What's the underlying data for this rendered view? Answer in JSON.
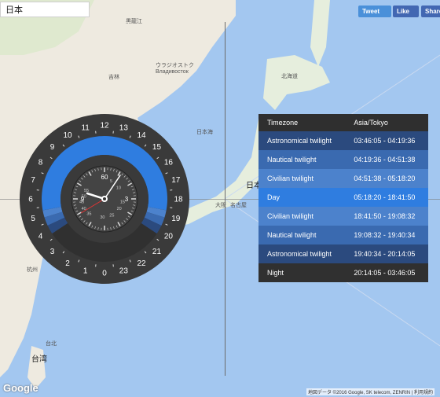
{
  "search": {
    "value": "日本"
  },
  "social": {
    "tweet": "Tweet",
    "like": "Like",
    "share": "Share"
  },
  "colors": {
    "day": "#2f7de0",
    "civil": "#4c82cc",
    "nautical": "#3a6ab0",
    "astro": "#2b4a7e",
    "night": "#303030",
    "dial": "#3a3a3a"
  },
  "clock": {
    "hour_labels": [
      "0",
      "1",
      "2",
      "3",
      "4",
      "5",
      "6",
      "7",
      "8",
      "9",
      "10",
      "11",
      "12",
      "13",
      "14",
      "15",
      "16",
      "17",
      "18",
      "19",
      "20",
      "21",
      "22",
      "23"
    ],
    "inner_labels": [
      "55",
      "50",
      "45",
      "40",
      "35",
      "30",
      "25",
      "20",
      "15",
      "10",
      "5",
      "3",
      "9",
      "60"
    ]
  },
  "timezone_table": {
    "header": {
      "label": "Timezone",
      "value": "Asia/Tokyo"
    },
    "rows": [
      {
        "label": "Astronomical twilight",
        "value": "03:46:05 - 04:19:36",
        "color": "#2b4a7e"
      },
      {
        "label": "Nautical twilight",
        "value": "04:19:36 - 04:51:38",
        "color": "#3a6ab0"
      },
      {
        "label": "Civilian twilight",
        "value": "04:51:38 - 05:18:20",
        "color": "#4c82cc"
      },
      {
        "label": "Day",
        "value": "05:18:20 - 18:41:50",
        "color": "#2f7de0"
      },
      {
        "label": "Civilian twilight",
        "value": "18:41:50 - 19:08:32",
        "color": "#4c82cc"
      },
      {
        "label": "Nautical twilight",
        "value": "19:08:32 - 19:40:34",
        "color": "#3a6ab0"
      },
      {
        "label": "Astronomical twilight",
        "value": "19:40:34 - 20:14:05",
        "color": "#2b4a7e"
      },
      {
        "label": "Night",
        "value": "20:14:05 - 03:46:05",
        "color": "#303030"
      }
    ]
  },
  "map": {
    "labels": [
      "黒龍江",
      "吉林",
      "ウラジオストク",
      "Владивосток",
      "北海道",
      "日本海",
      "日本",
      "大阪",
      "名古屋",
      "杭州",
      "台湾",
      "台北"
    ],
    "google": "Google",
    "attribution": "地図データ ©2016 Google, SK telecom, ZENRIN | 利用規約"
  }
}
